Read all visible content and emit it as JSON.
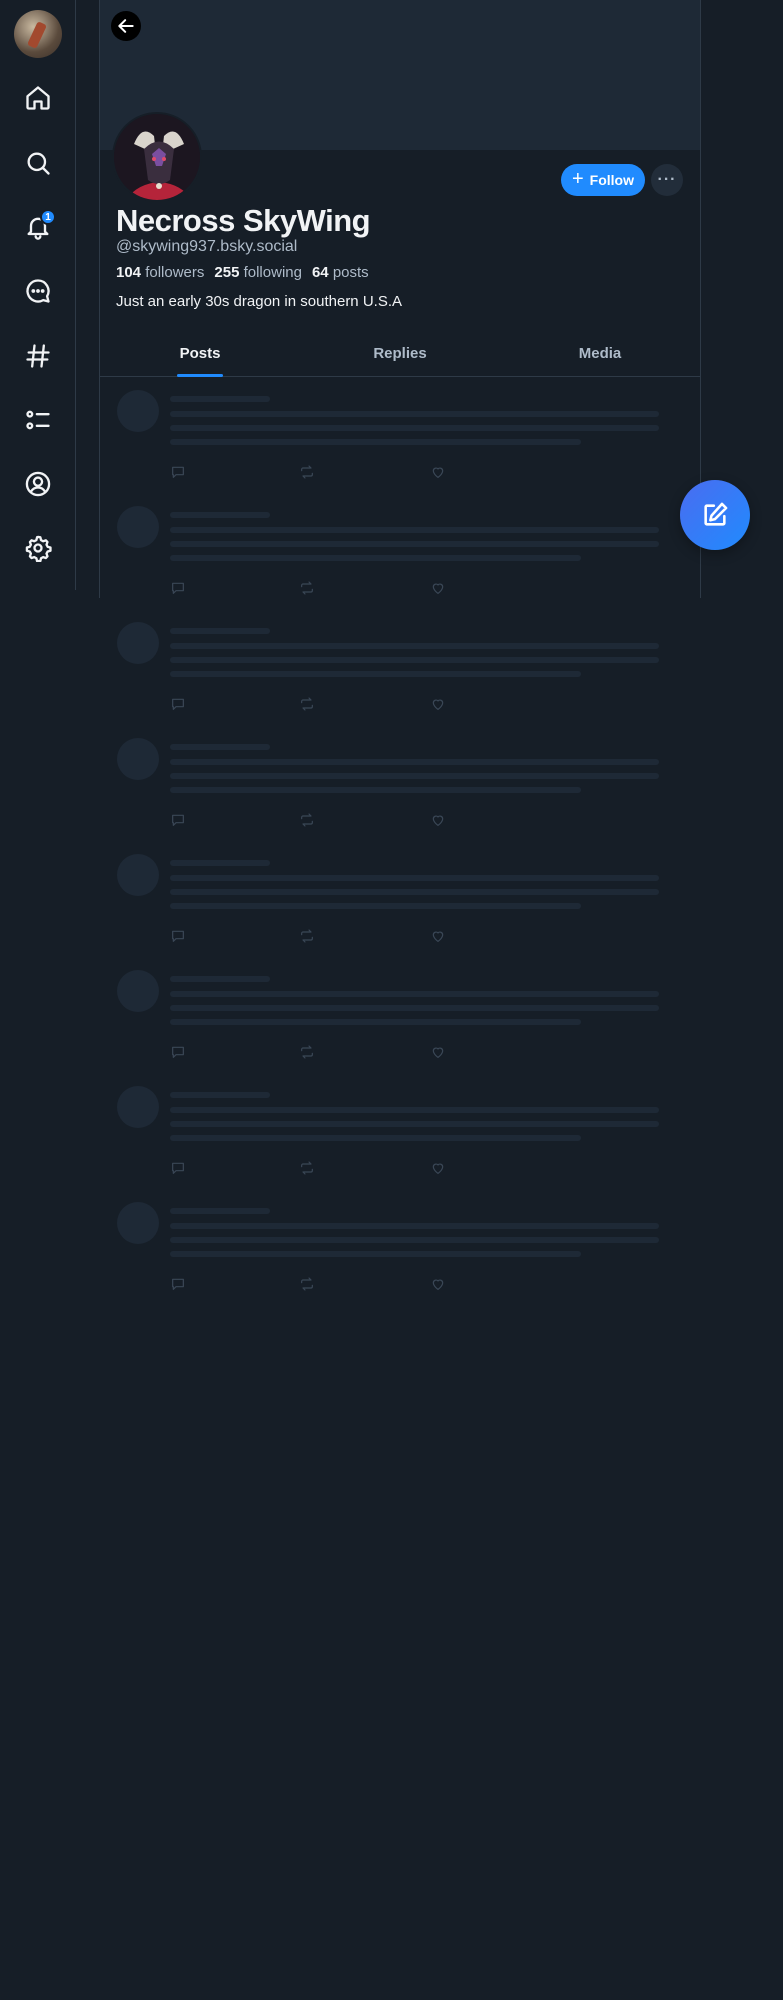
{
  "nav": {
    "items": [
      {
        "name": "home",
        "icon": "home-icon"
      },
      {
        "name": "search",
        "icon": "search-icon"
      },
      {
        "name": "notifications",
        "icon": "bell-icon",
        "badge": "1"
      },
      {
        "name": "chat",
        "icon": "chat-icon"
      },
      {
        "name": "feeds",
        "icon": "hashtag-icon"
      },
      {
        "name": "lists",
        "icon": "list-icon"
      },
      {
        "name": "profile",
        "icon": "user-circle-icon"
      },
      {
        "name": "settings",
        "icon": "gear-icon"
      }
    ]
  },
  "profile": {
    "display_name": "Necross SkyWing",
    "handle": "@skywing937.bsky.social",
    "followers_count": "104",
    "followers_label": "followers",
    "following_count": "255",
    "following_label": "following",
    "posts_count": "64",
    "posts_label": "posts",
    "bio": "Just an early 30s dragon in southern U.S.A",
    "follow_label": "Follow",
    "more_label": "···"
  },
  "tabs": [
    {
      "label": "Posts",
      "active": true
    },
    {
      "label": "Replies",
      "active": false
    },
    {
      "label": "Media",
      "active": false
    }
  ],
  "feed": {
    "skeleton_count": 8
  },
  "colors": {
    "background": "#161e27",
    "accent": "#208bfe",
    "border": "#2e3a47",
    "muted_text": "#aebbc9"
  }
}
